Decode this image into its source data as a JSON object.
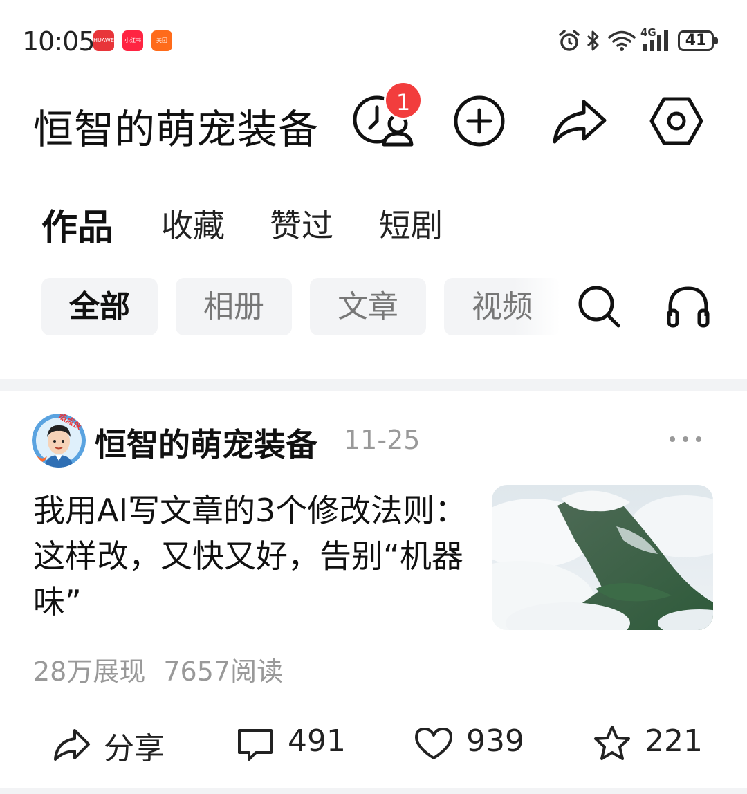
{
  "status_bar": {
    "time": "10:05",
    "app_badges": [
      {
        "label": "HUAWEI",
        "color": "#e8353a"
      },
      {
        "label": "小红书",
        "color": "#ff2442"
      },
      {
        "label": "美团",
        "color": "#ff6b1a"
      }
    ],
    "icons": [
      "alarm-icon",
      "bluetooth-icon",
      "wifi-icon",
      "signal-4g-icon",
      "battery-icon"
    ],
    "network": "4G",
    "battery": "41"
  },
  "header": {
    "title": "恒智的萌宠装备",
    "notification_count": "1",
    "icons": [
      "visitors-icon",
      "add-icon",
      "share-icon",
      "settings-icon"
    ]
  },
  "main_tabs": [
    {
      "label": "作品",
      "active": true
    },
    {
      "label": "收藏",
      "active": false
    },
    {
      "label": "赞过",
      "active": false
    },
    {
      "label": "短剧",
      "active": false
    }
  ],
  "filter_chips": [
    {
      "label": "全部",
      "active": true
    },
    {
      "label": "相册",
      "active": false
    },
    {
      "label": "文章",
      "active": false
    },
    {
      "label": "视频",
      "active": false
    }
  ],
  "post": {
    "author": "恒智的萌宠装备",
    "avatar_badge": "热点侠",
    "date": "11-25",
    "title": "我用AI写文章的3个修改法则：这样改，又快又好，告别“机器味”",
    "impressions": "28万展现",
    "reads": "7657阅读",
    "actions": {
      "share": "分享",
      "comments": "491",
      "likes": "939",
      "favorites": "221"
    }
  },
  "colors": {
    "accent_red": "#f23d3d",
    "chip_bg": "#f3f4f6",
    "muted_text": "#999999"
  }
}
